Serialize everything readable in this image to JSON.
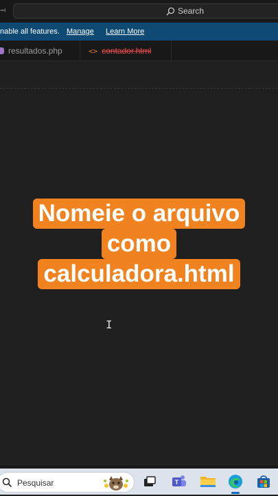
{
  "titlebar": {
    "nav_arrow": "→",
    "search_label": "Search"
  },
  "infobar": {
    "message": "nable all features.",
    "manage_link": "Manage",
    "learn_more_link": "Learn More"
  },
  "tabs": [
    {
      "label": "resultados.php",
      "icon": "php-file-icon"
    },
    {
      "label": "contador.html",
      "icon": "html-file-icon",
      "state": "deleted"
    }
  ],
  "overlay": {
    "lines": [
      "Nomeie o arquivo",
      "como",
      "calculadora.html"
    ],
    "color": "#f0831f"
  },
  "taskbar": {
    "search_placeholder": "Pesquisar",
    "apps": [
      "task-view-icon",
      "teams-icon",
      "file-explorer-icon",
      "edge-icon",
      "store-icon"
    ]
  },
  "colors": {
    "editor_bg": "#1f1f1f",
    "infobar_bg": "#0e4a74",
    "deleted_tab_text": "#f14c4c"
  }
}
